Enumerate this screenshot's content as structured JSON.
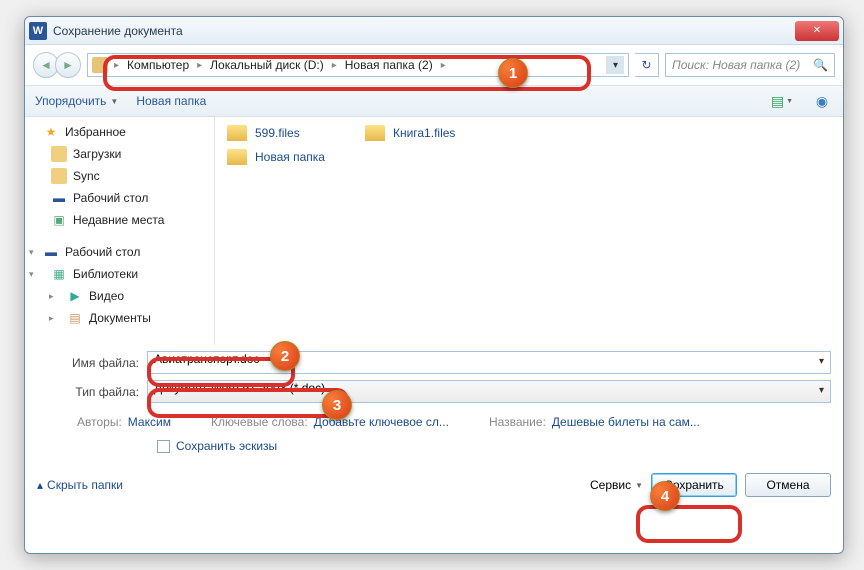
{
  "title": "Сохранение документа",
  "word_icon": "W",
  "breadcrumbs": [
    "Компьютер",
    "Локальный диск (D:)",
    "Новая папка (2)"
  ],
  "search_placeholder": "Поиск: Новая папка (2)",
  "toolbar": {
    "organize": "Упорядочить",
    "newfolder": "Новая папка"
  },
  "sidebar": {
    "favorites": {
      "label": "Избранное",
      "items": [
        "Загрузки",
        "Sync",
        "Рабочий стол",
        "Недавние места"
      ]
    },
    "desktop": {
      "label": "Рабочий стол",
      "libs": "Библиотеки",
      "items": [
        "Видео",
        "Документы"
      ]
    }
  },
  "files": [
    "599.files",
    "Книга1.files",
    "Новая папка"
  ],
  "filename_label": "Имя файла:",
  "filename_value": "Авиатранспорт.doc",
  "filetype_label": "Тип файла:",
  "filetype_value": "Документ Word 97-2003 (*.doc)",
  "meta": {
    "authors_label": "Авторы:",
    "authors_value": "Максим",
    "keywords_label": "Ключевые слова:",
    "keywords_value": "Добавьте ключевое сл...",
    "title_label": "Название:",
    "title_value": "Дешевые билеты на сам..."
  },
  "save_thumbs": "Сохранить эскизы",
  "hide_folders": "Скрыть папки",
  "tools": "Сервис",
  "save_btn": "Сохранить",
  "cancel_btn": "Отмена"
}
